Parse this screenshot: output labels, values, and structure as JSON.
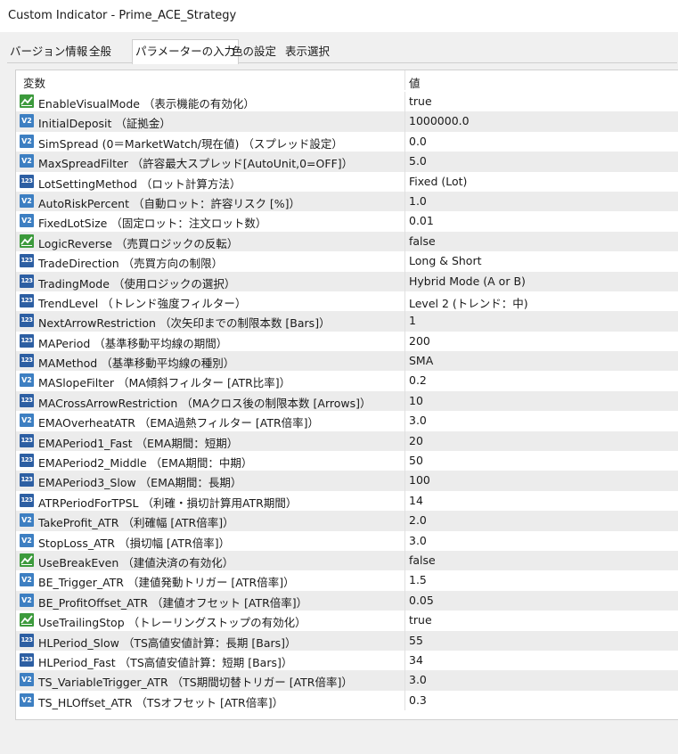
{
  "window": {
    "title": "Custom Indicator - Prime_ACE_Strategy"
  },
  "tabs": [
    {
      "label": "バージョン情報"
    },
    {
      "label": "全般"
    },
    {
      "label": "パラメーターの入力",
      "active": true
    },
    {
      "label": "色の設定"
    },
    {
      "label": "表示選択"
    }
  ],
  "table": {
    "col_variable": "変数",
    "col_value": "値",
    "rows": [
      {
        "icon": "bool",
        "name": "EnableVisualMode （表示機能の有効化）",
        "value": "true"
      },
      {
        "icon": "double",
        "name": "InitialDeposit （証拠金）",
        "value": "1000000.0"
      },
      {
        "icon": "double",
        "name": "SimSpread (0＝MarketWatch/現在値) （スプレッド設定）",
        "value": "0.0"
      },
      {
        "icon": "double",
        "name": "MaxSpreadFilter （許容最大スプレッド[AutoUnit,0=OFF]）",
        "value": "5.0"
      },
      {
        "icon": "int",
        "name": "LotSettingMethod （ロット計算方法）",
        "value": "Fixed (Lot)"
      },
      {
        "icon": "double",
        "name": "AutoRiskPercent （自動ロット：許容リスク [%]）",
        "value": "1.0"
      },
      {
        "icon": "double",
        "name": "FixedLotSize （固定ロット：注文ロット数）",
        "value": "0.01"
      },
      {
        "icon": "bool",
        "name": "LogicReverse （売買ロジックの反転）",
        "value": "false"
      },
      {
        "icon": "int",
        "name": "TradeDirection （売買方向の制限）",
        "value": "Long & Short"
      },
      {
        "icon": "int",
        "name": "TradingMode （使用ロジックの選択）",
        "value": "Hybrid Mode (A or B)"
      },
      {
        "icon": "int",
        "name": "TrendLevel （トレンド強度フィルター）",
        "value": "Level 2 (トレンド：中)"
      },
      {
        "icon": "int",
        "name": "NextArrowRestriction （次矢印までの制限本数 [Bars]）",
        "value": "1"
      },
      {
        "icon": "int",
        "name": "MAPeriod （基準移動平均線の期間）",
        "value": "200"
      },
      {
        "icon": "int",
        "name": "MAMethod （基準移動平均線の種別）",
        "value": "SMA"
      },
      {
        "icon": "double",
        "name": "MASlopeFilter （MA傾斜フィルター [ATR比率]）",
        "value": "0.2"
      },
      {
        "icon": "int",
        "name": "MACrossArrowRestriction （MAクロス後の制限本数 [Arrows]）",
        "value": "10"
      },
      {
        "icon": "double",
        "name": "EMAOverheatATR （EMA過熱フィルター [ATR倍率]）",
        "value": "3.0"
      },
      {
        "icon": "int",
        "name": "EMAPeriod1_Fast （EMA期間：短期）",
        "value": "20"
      },
      {
        "icon": "int",
        "name": "EMAPeriod2_Middle （EMA期間：中期）",
        "value": "50"
      },
      {
        "icon": "int",
        "name": "EMAPeriod3_Slow （EMA期間：長期）",
        "value": "100"
      },
      {
        "icon": "int",
        "name": "ATRPeriodForTPSL （利確・損切計算用ATR期間）",
        "value": "14"
      },
      {
        "icon": "double",
        "name": "TakeProfit_ATR （利確幅 [ATR倍率]）",
        "value": "2.0"
      },
      {
        "icon": "double",
        "name": "StopLoss_ATR （損切幅 [ATR倍率]）",
        "value": "3.0"
      },
      {
        "icon": "bool",
        "name": "UseBreakEven （建値決済の有効化）",
        "value": "false"
      },
      {
        "icon": "double",
        "name": "BE_Trigger_ATR （建値発動トリガー [ATR倍率]）",
        "value": "1.5"
      },
      {
        "icon": "double",
        "name": "BE_ProfitOffset_ATR （建値オフセット [ATR倍率]）",
        "value": "0.05"
      },
      {
        "icon": "bool",
        "name": "UseTrailingStop （トレーリングストップの有効化）",
        "value": "true"
      },
      {
        "icon": "int",
        "name": "HLPeriod_Slow （TS高値安値計算：長期 [Bars]）",
        "value": "55"
      },
      {
        "icon": "int",
        "name": "HLPeriod_Fast （TS高値安値計算：短期 [Bars]）",
        "value": "34"
      },
      {
        "icon": "double",
        "name": "TS_VariableTrigger_ATR （TS期間切替トリガー [ATR倍率]）",
        "value": "3.0"
      },
      {
        "icon": "double",
        "name": "TS_HLOffset_ATR （TSオフセット [ATR倍率]）",
        "value": "0.3"
      }
    ]
  },
  "icons": {
    "bool": "bool-icon",
    "double": "double-icon",
    "int": "integer-icon"
  },
  "colors": {
    "bool_icon": "#3c9a3c",
    "double_icon": "#3d7fc2",
    "int_icon": "#2d5fa3",
    "alt_row": "#ececec"
  }
}
